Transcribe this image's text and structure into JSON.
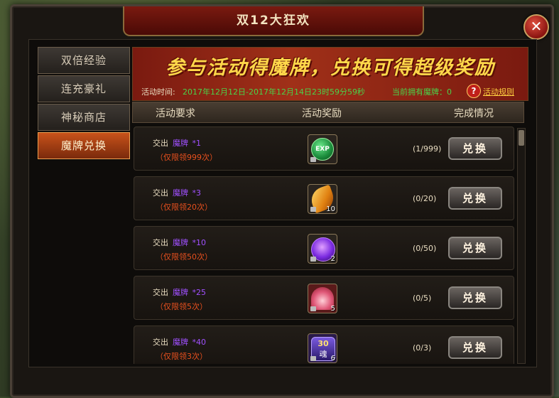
{
  "window": {
    "title": "双12大狂欢",
    "close_label": "✕"
  },
  "tabs": [
    {
      "label": "双倍经验",
      "active": false
    },
    {
      "label": "连充豪礼",
      "active": false
    },
    {
      "label": "神秘商店",
      "active": false
    },
    {
      "label": "魔牌兑换",
      "active": true
    }
  ],
  "banner": {
    "title": "参与活动得魔牌，兑换可得超级奖励",
    "time_label": "活动时间:",
    "time_value": "2017年12月12日-2017年12月14日23时59分59秒",
    "owned_label": "当前拥有魔牌：0",
    "help_icon": "?",
    "rules_link": "活动规则"
  },
  "columns": {
    "requirement": "活动要求",
    "reward": "活动奖励",
    "status": "完成情况"
  },
  "rows": [
    {
      "req_prefix": "交出",
      "req_item": "魔牌",
      "req_qty": "*1",
      "limit": "（仅限领999次）",
      "reward_icon": "exp-orb-icon",
      "reward_count": "",
      "progress": "(1/999)",
      "button": "兑换"
    },
    {
      "req_prefix": "交出",
      "req_item": "魔牌",
      "req_qty": "*3",
      "limit": "（仅限领20次）",
      "reward_icon": "golden-feather-icon",
      "reward_count": "10",
      "progress": "(0/20)",
      "button": "兑换"
    },
    {
      "req_prefix": "交出",
      "req_item": "魔牌",
      "req_qty": "*10",
      "limit": "（仅限领50次）",
      "reward_icon": "purple-orb-icon",
      "reward_count": "2",
      "progress": "(0/50)",
      "button": "兑换"
    },
    {
      "req_prefix": "交出",
      "req_item": "魔牌",
      "req_qty": "*25",
      "limit": "（仅限领5次）",
      "reward_icon": "lotus-flower-icon",
      "reward_count": "5",
      "progress": "(0/5)",
      "button": "兑换"
    },
    {
      "req_prefix": "交出",
      "req_item": "魔牌",
      "req_qty": "*40",
      "limit": "（仅限领3次）",
      "reward_icon": "soul-30-badge-icon",
      "reward_count": "6",
      "progress": "(0/3)",
      "button": "兑换",
      "badge_text": "30",
      "badge_sub": "魂"
    }
  ]
}
